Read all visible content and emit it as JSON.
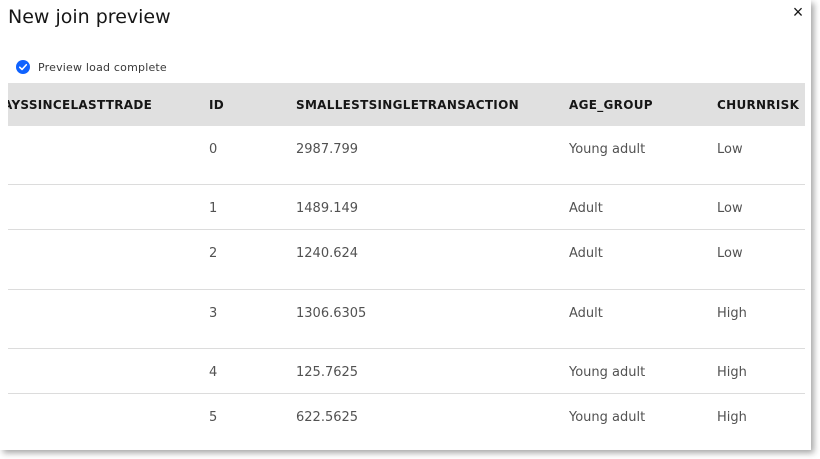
{
  "modal": {
    "title": "New join preview",
    "close_glyph": "×",
    "close_icon": "close-icon"
  },
  "status": {
    "icon": "checkmark-filled-icon",
    "color": "#0f62fe",
    "text": "Preview load complete"
  },
  "table": {
    "columns": [
      "AYSSINCELASTTRADE",
      "ID",
      "SMALLESTSINGLETRANSACTION",
      "AGE_GROUP",
      "CHURNRISK"
    ],
    "rows": [
      {
        "days": "",
        "id": "0",
        "smallest": "2987.799",
        "age_group": "Young adult",
        "churnrisk": "Low"
      },
      {
        "days": "",
        "id": "1",
        "smallest": "1489.149",
        "age_group": "Adult",
        "churnrisk": "Low"
      },
      {
        "days": "",
        "id": "2",
        "smallest": "1240.624",
        "age_group": "Adult",
        "churnrisk": "Low"
      },
      {
        "days": "",
        "id": "3",
        "smallest": "1306.6305",
        "age_group": "Adult",
        "churnrisk": "High"
      },
      {
        "days": "",
        "id": "4",
        "smallest": "125.7625",
        "age_group": "Young adult",
        "churnrisk": "High"
      },
      {
        "days": "",
        "id": "5",
        "smallest": "622.5625",
        "age_group": "Young adult",
        "churnrisk": "High"
      }
    ]
  },
  "colors": {
    "header_bg": "#e0e0e0",
    "row_divider": "#dcdcdc",
    "text_primary": "#161616",
    "text_secondary": "#525252"
  }
}
